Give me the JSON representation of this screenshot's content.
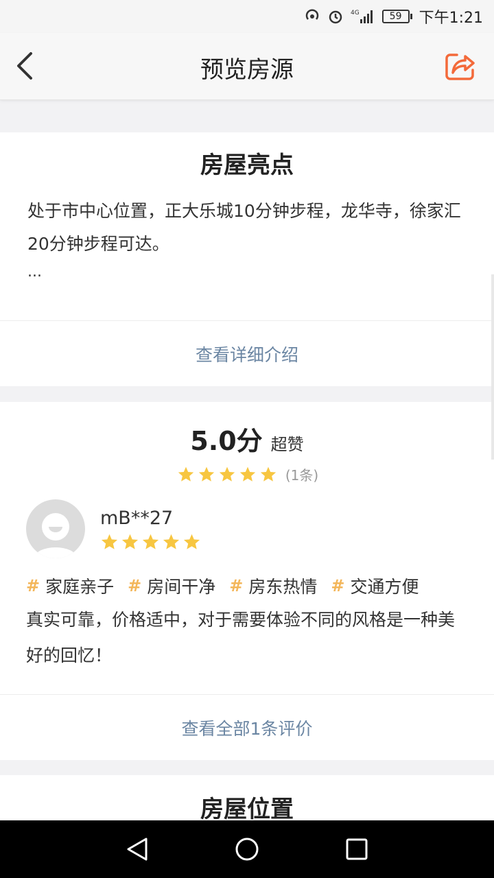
{
  "status": {
    "battery": "59",
    "time": "下午1:21",
    "network": "4G"
  },
  "header": {
    "title": "预览房源"
  },
  "highlights": {
    "title": "房屋亮点",
    "text": "处于市中心位置，正大乐城10分钟步程，龙华寺，徐家汇20分钟步程可达。",
    "ellipsis": "...",
    "link": "查看详细介绍"
  },
  "reviews": {
    "score": "5.0分",
    "score_word": "超赞",
    "rating": 5,
    "count": "(1条)",
    "reviewer": {
      "name": "mB**27",
      "rating": 5
    },
    "tags": [
      "家庭亲子",
      "房间干净",
      "房东热情",
      "交通方便"
    ],
    "comment": "真实可靠，价格适中，对于需要体验不同的风格是一种美好的回忆！",
    "link": "查看全部1条评价"
  },
  "location": {
    "title": "房屋位置"
  },
  "colors": {
    "accent": "#f36a3a",
    "star": "#f7c641",
    "link": "#6b86a3"
  }
}
